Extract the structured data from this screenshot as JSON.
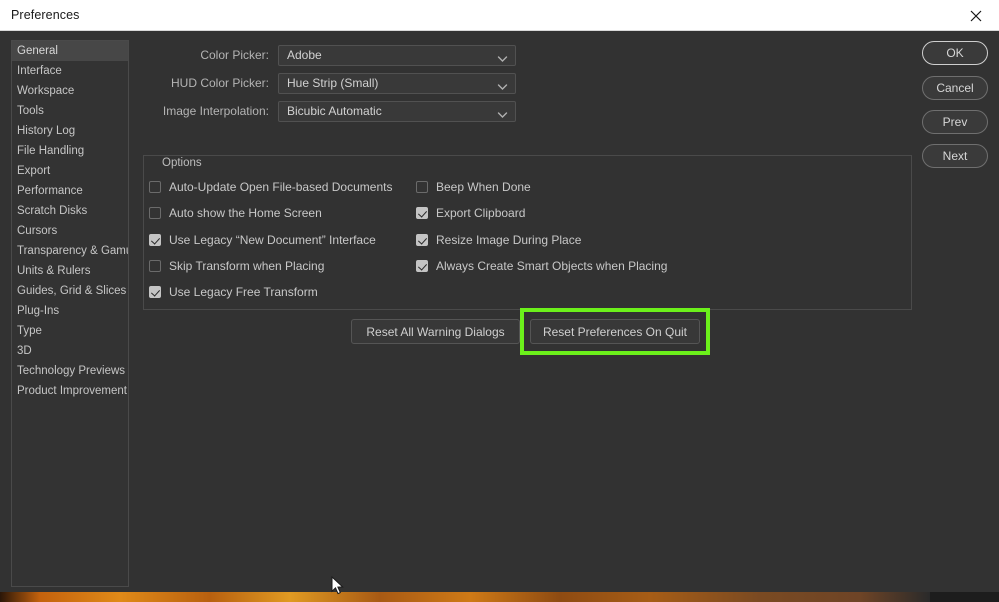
{
  "window": {
    "title": "Preferences",
    "close_icon": "close-icon"
  },
  "sidebar": {
    "items": [
      {
        "label": "General",
        "selected": true
      },
      {
        "label": "Interface",
        "selected": false
      },
      {
        "label": "Workspace",
        "selected": false
      },
      {
        "label": "Tools",
        "selected": false
      },
      {
        "label": "History Log",
        "selected": false
      },
      {
        "label": "File Handling",
        "selected": false
      },
      {
        "label": "Export",
        "selected": false
      },
      {
        "label": "Performance",
        "selected": false
      },
      {
        "label": "Scratch Disks",
        "selected": false
      },
      {
        "label": "Cursors",
        "selected": false
      },
      {
        "label": "Transparency & Gamut",
        "selected": false
      },
      {
        "label": "Units & Rulers",
        "selected": false
      },
      {
        "label": "Guides, Grid & Slices",
        "selected": false
      },
      {
        "label": "Plug-Ins",
        "selected": false
      },
      {
        "label": "Type",
        "selected": false
      },
      {
        "label": "3D",
        "selected": false
      },
      {
        "label": "Technology Previews",
        "selected": false
      },
      {
        "label": "Product Improvement",
        "selected": false
      }
    ]
  },
  "form": {
    "rows": [
      {
        "label": "Color Picker:",
        "value": "Adobe"
      },
      {
        "label": "HUD Color Picker:",
        "value": "Hue Strip (Small)"
      },
      {
        "label": "Image Interpolation:",
        "value": "Bicubic Automatic"
      }
    ]
  },
  "options": {
    "legend": "Options",
    "left_column": [
      {
        "label": "Auto-Update Open File-based Documents",
        "checked": false
      },
      {
        "label": "Auto show the Home Screen",
        "checked": false
      },
      {
        "label": "Use Legacy “New Document” Interface",
        "checked": true
      },
      {
        "label": "Skip Transform when Placing",
        "checked": false
      },
      {
        "label": "Use Legacy Free Transform",
        "checked": true
      }
    ],
    "right_column": [
      {
        "label": "Beep When Done",
        "checked": false
      },
      {
        "label": "Export Clipboard",
        "checked": true
      },
      {
        "label": "Resize Image During Place",
        "checked": true
      },
      {
        "label": "Always Create Smart Objects when Placing",
        "checked": true
      }
    ]
  },
  "reset_buttons": [
    {
      "label": "Reset All Warning Dialogs",
      "highlighted": false
    },
    {
      "label": "Reset Preferences On Quit",
      "highlighted": true
    }
  ],
  "action_buttons": [
    {
      "label": "OK",
      "primary": true
    },
    {
      "label": "Cancel",
      "primary": false
    },
    {
      "label": "Prev",
      "primary": false
    },
    {
      "label": "Next",
      "primary": false
    }
  ],
  "colors": {
    "highlight": "#6cf01b",
    "dialog_background": "#323232",
    "titlebar_background": "#ffffff",
    "text": "#c8c8c8"
  }
}
